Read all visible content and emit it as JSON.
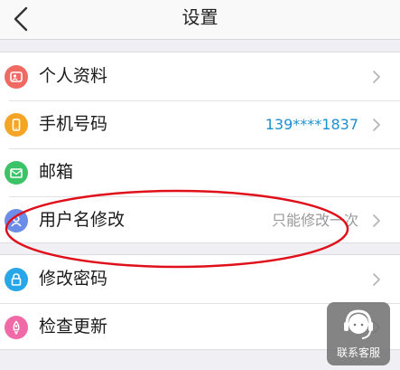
{
  "nav": {
    "title": "设置",
    "back_icon": "chevron-left-icon"
  },
  "settings": {
    "group1": [
      {
        "label": "个人资料",
        "value": "",
        "icon": "profile-icon",
        "icon_color": "#ef6a62",
        "chevron": true
      },
      {
        "label": "手机号码",
        "value": "139****1837",
        "icon": "phone-icon",
        "icon_color": "#f5a523",
        "chevron": true
      },
      {
        "label": "邮箱",
        "value": "",
        "icon": "mail-icon",
        "icon_color": "#3cc368",
        "chevron": false
      },
      {
        "label": "用户名修改",
        "value": "只能修改一次",
        "icon": "user-icon",
        "icon_color": "#6b8de8",
        "chevron": true
      }
    ],
    "group2": [
      {
        "label": "修改密码",
        "value": "",
        "icon": "lock-icon",
        "icon_color": "#27a6e8",
        "chevron": true
      },
      {
        "label": "检查更新",
        "value": "",
        "icon": "rocket-icon",
        "icon_color": "#f06aa8",
        "chevron": true
      }
    ]
  },
  "annotation": {
    "color": "#e0101a"
  },
  "service": {
    "label": "联系客服",
    "icon": "headset-icon"
  },
  "colors": {
    "accent_value": "#1c8fd0",
    "background": "#efeff4"
  }
}
